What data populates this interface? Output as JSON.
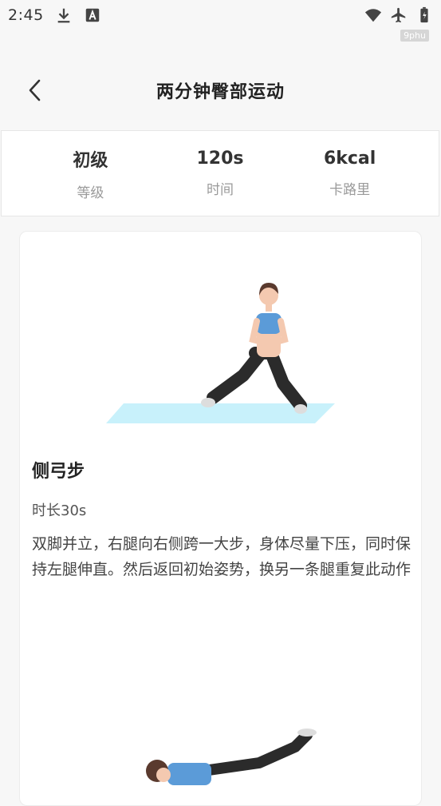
{
  "status_bar": {
    "time": "2:45",
    "icons_left": [
      "download-icon",
      "font-icon"
    ],
    "icons_right": [
      "wifi-icon",
      "airplane-icon",
      "battery-icon"
    ]
  },
  "watermark": "9phu",
  "header": {
    "back_icon": "chevron-left-icon",
    "title": "两分钟臀部运动"
  },
  "stats": [
    {
      "value": "初级",
      "label": "等级"
    },
    {
      "value": "120s",
      "label": "时间"
    },
    {
      "value": "6kcal",
      "label": "卡路里"
    }
  ],
  "exercise": {
    "name": "侧弓步",
    "duration": "时长30s",
    "description": "双脚并立，右腿向右侧跨一大步，身体尽量下压，同时保持左腿伸直。然后返回初始姿势，换另一条腿重复此动作"
  },
  "colors": {
    "mat": "#c8f1fb",
    "top": "#5b9bd8",
    "pants": "#2b2b2b",
    "skin": "#f4c9b0",
    "hair": "#5a3a2e"
  }
}
